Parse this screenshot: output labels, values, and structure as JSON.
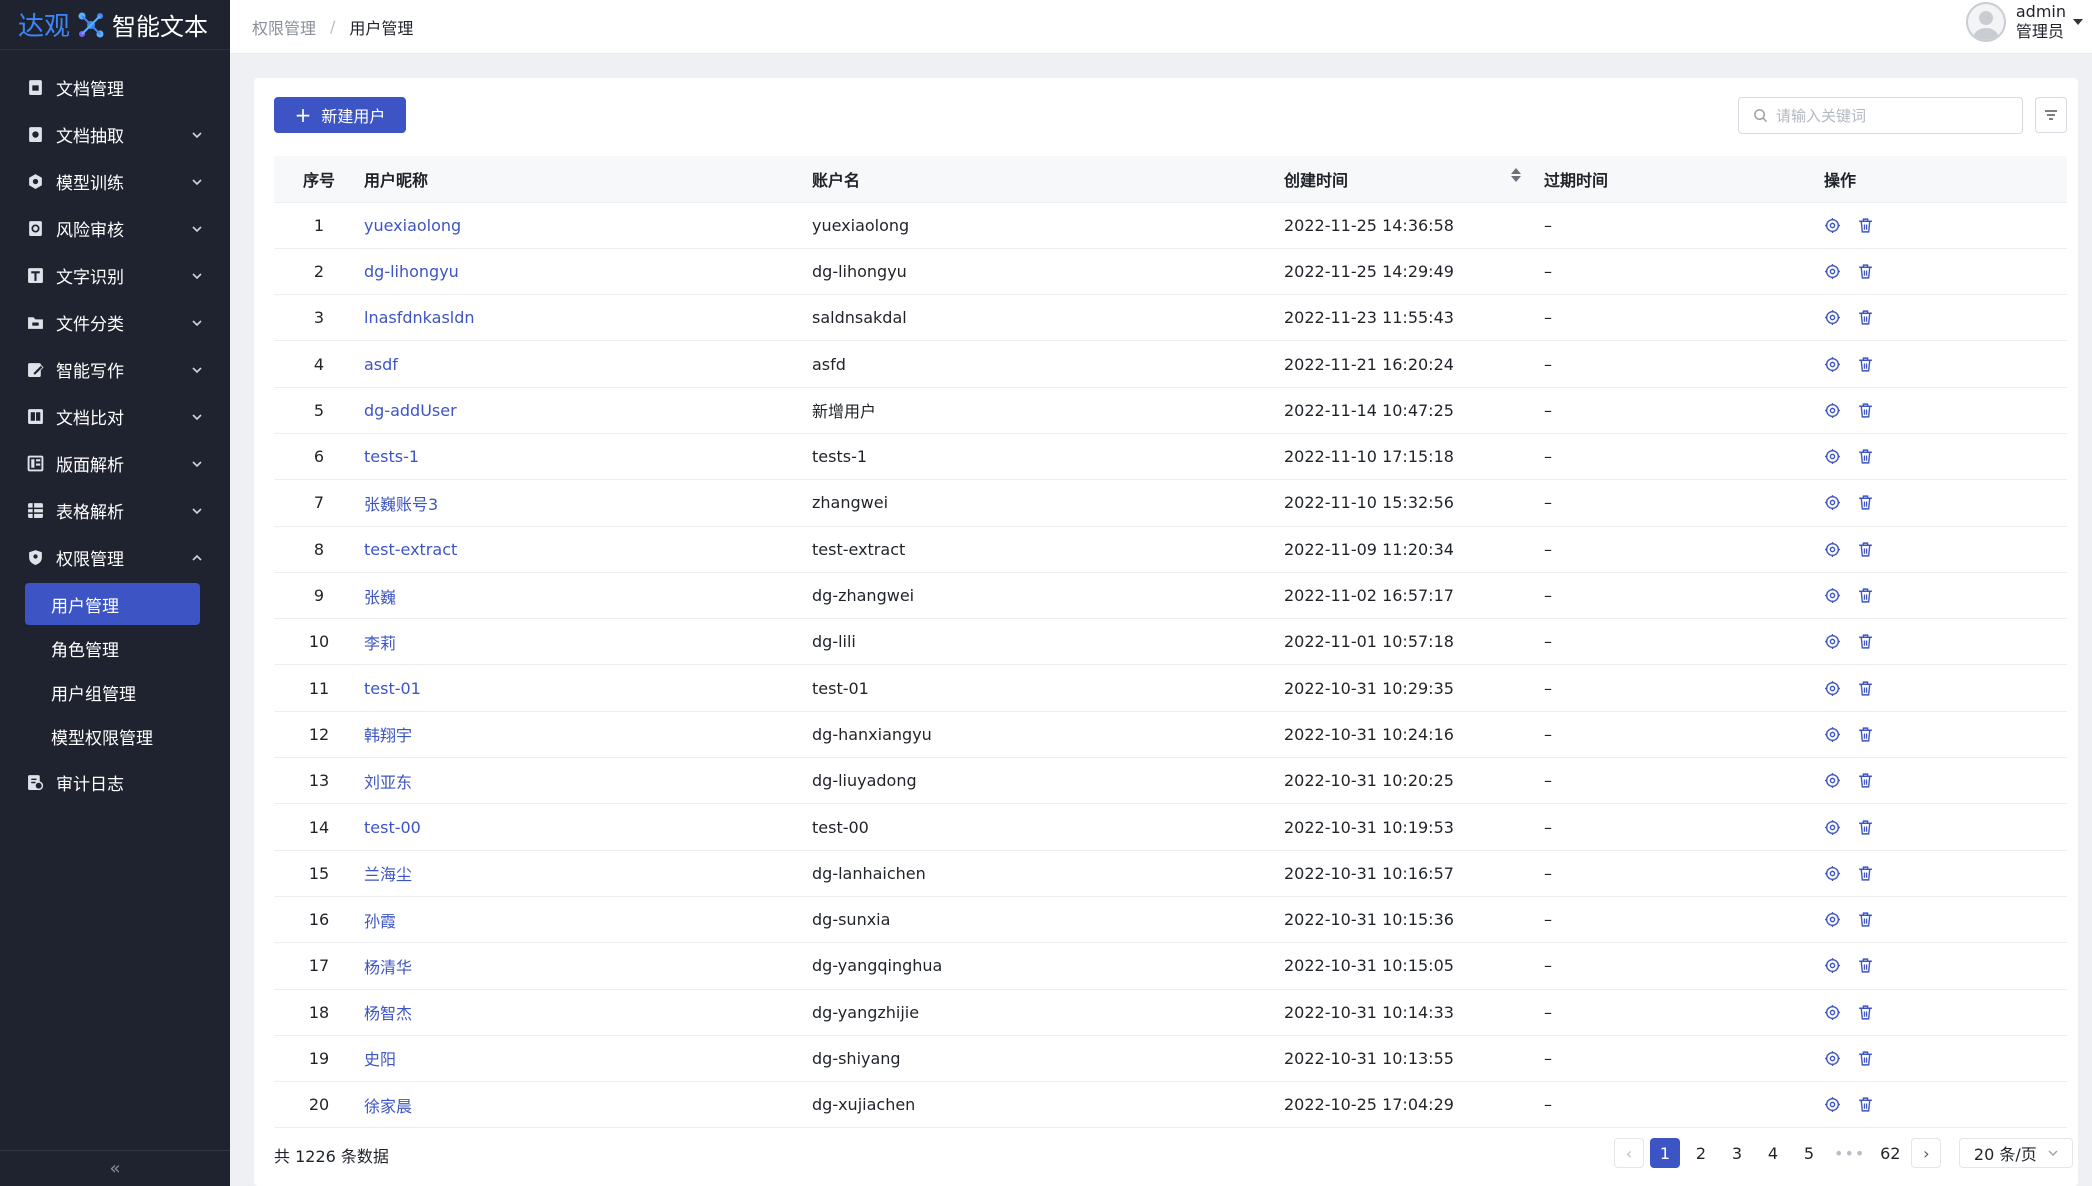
{
  "brand": {
    "name_left": "达观",
    "name_right": "智能文本"
  },
  "sidebar": {
    "items": [
      {
        "label": "文档管理",
        "icon": "document-icon",
        "has_children": false
      },
      {
        "label": "文档抽取",
        "icon": "extract-icon",
        "has_children": true
      },
      {
        "label": "模型训练",
        "icon": "model-icon",
        "has_children": true
      },
      {
        "label": "风险审核",
        "icon": "risk-icon",
        "has_children": true
      },
      {
        "label": "文字识别",
        "icon": "text-ocr-icon",
        "has_children": true
      },
      {
        "label": "文件分类",
        "icon": "folder-icon",
        "has_children": true
      },
      {
        "label": "智能写作",
        "icon": "edit-icon",
        "has_children": true
      },
      {
        "label": "文档比对",
        "icon": "compare-icon",
        "has_children": true
      },
      {
        "label": "版面解析",
        "icon": "layout-icon",
        "has_children": true
      },
      {
        "label": "表格解析",
        "icon": "table-icon",
        "has_children": true
      },
      {
        "label": "权限管理",
        "icon": "shield-icon",
        "has_children": true,
        "expanded": true
      }
    ],
    "sub_items": [
      {
        "label": "用户管理",
        "active": true
      },
      {
        "label": "角色管理",
        "active": false
      },
      {
        "label": "用户组管理",
        "active": false
      },
      {
        "label": "模型权限管理",
        "active": false
      }
    ],
    "audit": {
      "label": "审计日志",
      "icon": "audit-log-icon"
    },
    "collapse_glyph": "«"
  },
  "header": {
    "breadcrumb_parent": "权限管理",
    "breadcrumb_sep": "/",
    "breadcrumb_current": "用户管理",
    "user_name": "admin",
    "user_role": "管理员"
  },
  "toolbar": {
    "new_user_label": "新建用户",
    "search_placeholder": "请输入关键词"
  },
  "table": {
    "columns": {
      "index": "序号",
      "nickname": "用户昵称",
      "account": "账户名",
      "created": "创建时间",
      "expire": "过期时间",
      "ops": "操作"
    },
    "rows": [
      {
        "index": "1",
        "nickname": "yuexiaolong",
        "account": "yuexiaolong",
        "created": "2022-11-25 14:36:58",
        "expire": "–"
      },
      {
        "index": "2",
        "nickname": "dg-lihongyu",
        "account": "dg-lihongyu",
        "created": "2022-11-25 14:29:49",
        "expire": "–"
      },
      {
        "index": "3",
        "nickname": "lnasfdnkasldn",
        "account": "saldnsakdal",
        "created": "2022-11-23 11:55:43",
        "expire": "–"
      },
      {
        "index": "4",
        "nickname": "asdf",
        "account": "asfd",
        "created": "2022-11-21 16:20:24",
        "expire": "–"
      },
      {
        "index": "5",
        "nickname": "dg-addUser",
        "account": "新增用户",
        "created": "2022-11-14 10:47:25",
        "expire": "–"
      },
      {
        "index": "6",
        "nickname": "tests-1",
        "account": "tests-1",
        "created": "2022-11-10 17:15:18",
        "expire": "–"
      },
      {
        "index": "7",
        "nickname": "张巍账号3",
        "account": "zhangwei",
        "created": "2022-11-10 15:32:56",
        "expire": "–"
      },
      {
        "index": "8",
        "nickname": "test-extract",
        "account": "test-extract",
        "created": "2022-11-09 11:20:34",
        "expire": "–"
      },
      {
        "index": "9",
        "nickname": "张巍",
        "account": "dg-zhangwei",
        "created": "2022-11-02 16:57:17",
        "expire": "–"
      },
      {
        "index": "10",
        "nickname": "李莉",
        "account": "dg-lili",
        "created": "2022-11-01 10:57:18",
        "expire": "–"
      },
      {
        "index": "11",
        "nickname": "test-01",
        "account": "test-01",
        "created": "2022-10-31 10:29:35",
        "expire": "–"
      },
      {
        "index": "12",
        "nickname": "韩翔宇",
        "account": "dg-hanxiangyu",
        "created": "2022-10-31 10:24:16",
        "expire": "–"
      },
      {
        "index": "13",
        "nickname": "刘亚东",
        "account": "dg-liuyadong",
        "created": "2022-10-31 10:20:25",
        "expire": "–"
      },
      {
        "index": "14",
        "nickname": "test-00",
        "account": "test-00",
        "created": "2022-10-31 10:19:53",
        "expire": "–"
      },
      {
        "index": "15",
        "nickname": "兰海尘",
        "account": "dg-lanhaichen",
        "created": "2022-10-31 10:16:57",
        "expire": "–"
      },
      {
        "index": "16",
        "nickname": "孙霞",
        "account": "dg-sunxia",
        "created": "2022-10-31 10:15:36",
        "expire": "–"
      },
      {
        "index": "17",
        "nickname": "杨清华",
        "account": "dg-yangqinghua",
        "created": "2022-10-31 10:15:05",
        "expire": "–"
      },
      {
        "index": "18",
        "nickname": "杨智杰",
        "account": "dg-yangzhijie",
        "created": "2022-10-31 10:14:33",
        "expire": "–"
      },
      {
        "index": "19",
        "nickname": "史阳",
        "account": "dg-shiyang",
        "created": "2022-10-31 10:13:55",
        "expire": "–"
      },
      {
        "index": "20",
        "nickname": "徐家晨",
        "account": "dg-xujiachen",
        "created": "2022-10-25 17:04:29",
        "expire": "–"
      }
    ]
  },
  "footer": {
    "total_text": "共 1226 条数据",
    "pages": [
      "1",
      "2",
      "3",
      "4",
      "5"
    ],
    "current_page": "1",
    "ellipsis": "•••",
    "last_page": "62",
    "prev_glyph": "‹",
    "next_glyph": "›",
    "page_size": "20 条/页"
  },
  "colors": {
    "primary": "#3d55c4",
    "sidebar_bg": "#1f2330",
    "link": "#3d55c4"
  }
}
